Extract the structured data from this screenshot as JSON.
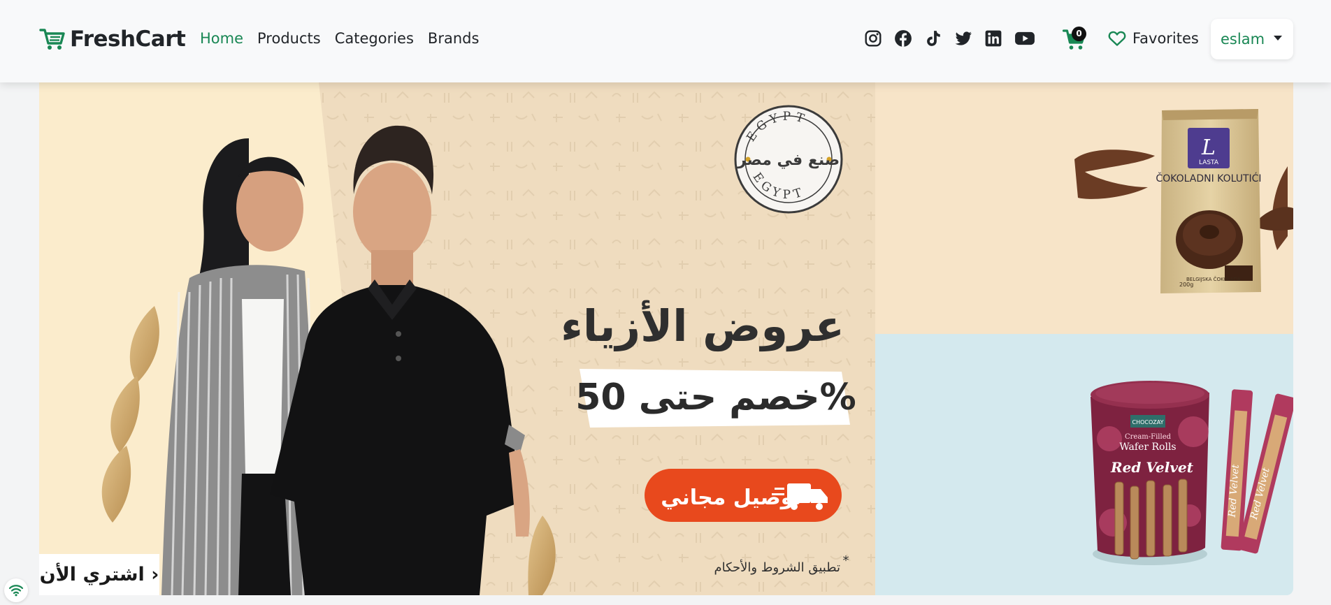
{
  "colors": {
    "brand": "#198754",
    "text": "#212529",
    "banner_bg": "#eedbbd",
    "offer_orange": "#e8491d"
  },
  "navbar": {
    "brand": "FreshCart",
    "links": [
      "Home",
      "Products",
      "Categories",
      "Brands"
    ],
    "active_link": "Home",
    "socials": [
      "instagram-icon",
      "facebook-icon",
      "tiktok-icon",
      "twitter-icon",
      "linkedin-icon",
      "youtube-icon"
    ],
    "cart_count": "0",
    "favorites": "Favorites",
    "user": "eslam"
  },
  "slider": {
    "title": "عروض الأزياء",
    "discount": "خصم حتى 50%",
    "delivery": "توصيل مجاني",
    "terms": "تطبيق الشروط والأحكام",
    "terms_mark": "*",
    "stamp_top": "EGYPT",
    "stamp_bottom": "EGYPT",
    "stamp_center": "صنع في مصر",
    "shop_now": "اشتري الأن ›"
  },
  "side_top": {
    "brand": "LASTA",
    "product": "ČOKOLADNI KOLUTIĆI",
    "sub": "BELGIJSKA ČOKOLADA",
    "weight": "200g"
  },
  "side_bottom": {
    "brand": "CHOCOZAY",
    "kind_1": "Cream-Filled",
    "kind_2": "Wafer Rolls",
    "flavor": "Red Velvet",
    "stick_label": "Red Velvet"
  }
}
